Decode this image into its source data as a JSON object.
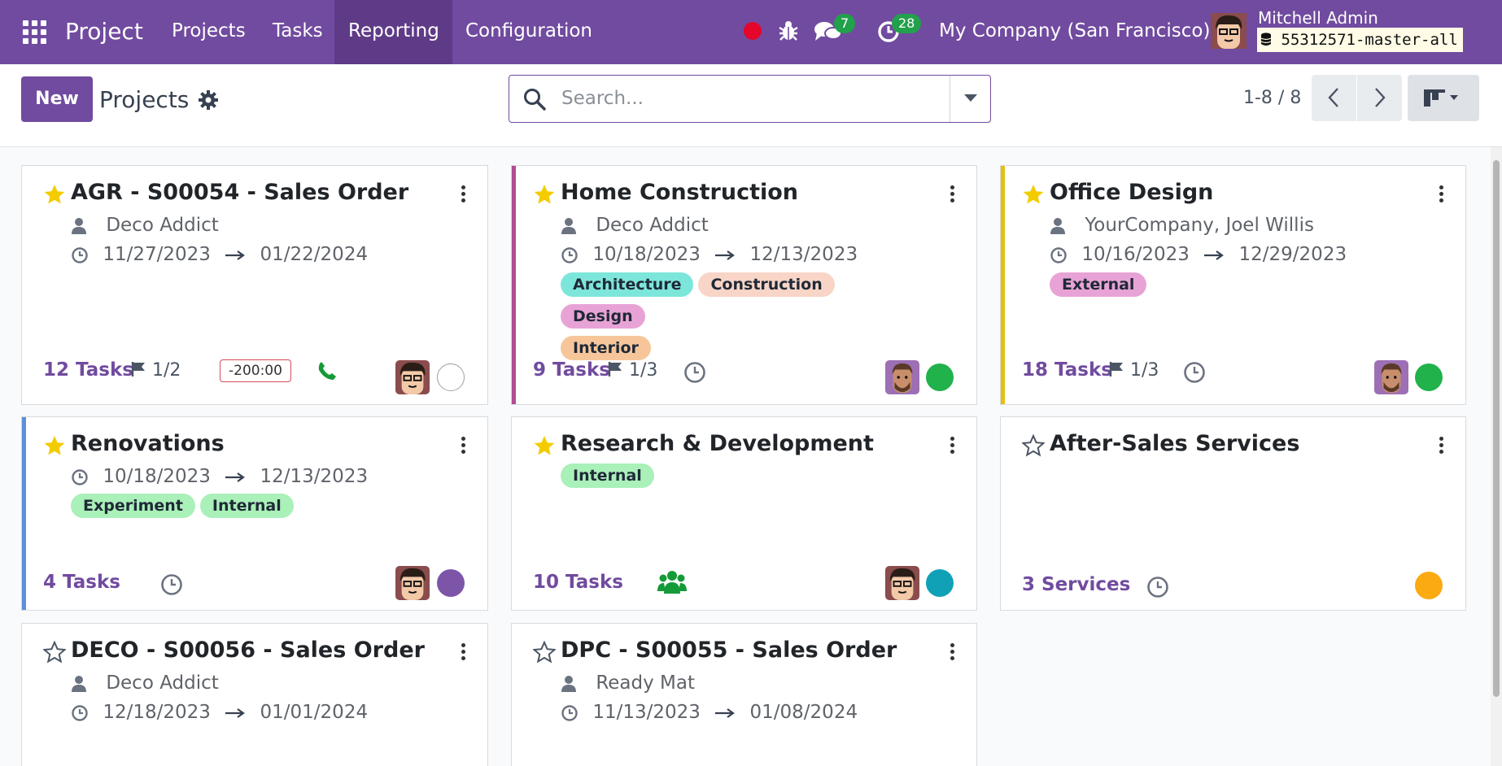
{
  "navbar": {
    "app_name": "Project",
    "menu": [
      "Projects",
      "Tasks",
      "Reporting",
      "Configuration"
    ],
    "active_menu": "Reporting",
    "messages_count": "7",
    "activities_count": "28",
    "company": "My Company (San Francisco)",
    "user_name": "Mitchell Admin",
    "database": "55312571-master-all"
  },
  "control": {
    "new_label": "New",
    "breadcrumb": "Projects",
    "search_placeholder": "Search...",
    "pager": "1-8 / 8"
  },
  "colors": {
    "brand": "#714b9f",
    "tag_architecture": "#7de6db",
    "tag_construction": "#f8d5c7",
    "tag_design": "#e8a3d6",
    "tag_interior": "#f6c69a",
    "tag_external": "#e8a3d6",
    "tag_experiment": "#aaf0b9",
    "tag_internal": "#aaf0b9"
  },
  "projects": [
    {
      "name": "AGR - S00054 - Sales Order",
      "favorite": true,
      "customer": "Deco Addict",
      "date_start": "11/27/2023",
      "date_end": "01/22/2024",
      "tags": [],
      "tasks_label": "12 Tasks",
      "milestones": "1/2",
      "deadline_badge": "-200:00",
      "status_color": "#e5e7eb"
    },
    {
      "name": "Home Construction",
      "favorite": true,
      "customer": "Deco Addict",
      "date_start": "10/18/2023",
      "date_end": "12/13/2023",
      "tags": [
        "Architecture",
        "Construction",
        "Design",
        "Interior"
      ],
      "tasks_label": "9 Tasks",
      "milestones": "1/3",
      "status_color": "#21b24b"
    },
    {
      "name": "Office Design",
      "favorite": true,
      "customer": "YourCompany, Joel Willis",
      "date_start": "10/16/2023",
      "date_end": "12/29/2023",
      "tags": [
        "External"
      ],
      "tasks_label": "18 Tasks",
      "milestones": "1/3",
      "status_color": "#21b24b"
    },
    {
      "name": "Renovations",
      "favorite": true,
      "date_start": "10/18/2023",
      "date_end": "12/13/2023",
      "tags": [
        "Experiment",
        "Internal"
      ],
      "tasks_label": "4 Tasks",
      "status_color": "#7c55a9"
    },
    {
      "name": "Research & Development",
      "favorite": true,
      "tags": [
        "Internal"
      ],
      "tasks_label": "10 Tasks",
      "status_color": "#11a1b7"
    },
    {
      "name": "After-Sales Services",
      "favorite": false,
      "tags": [],
      "tasks_label": "3 Services",
      "status_color": "#fbaa12"
    },
    {
      "name": "DECO - S00056 - Sales Order",
      "favorite": false,
      "customer": "Deco Addict",
      "date_start": "12/18/2023",
      "date_end": "01/01/2024"
    },
    {
      "name": "DPC - S00055 - Sales Order",
      "favorite": false,
      "customer": "Ready Mat",
      "date_start": "11/13/2023",
      "date_end": "01/08/2024"
    }
  ]
}
